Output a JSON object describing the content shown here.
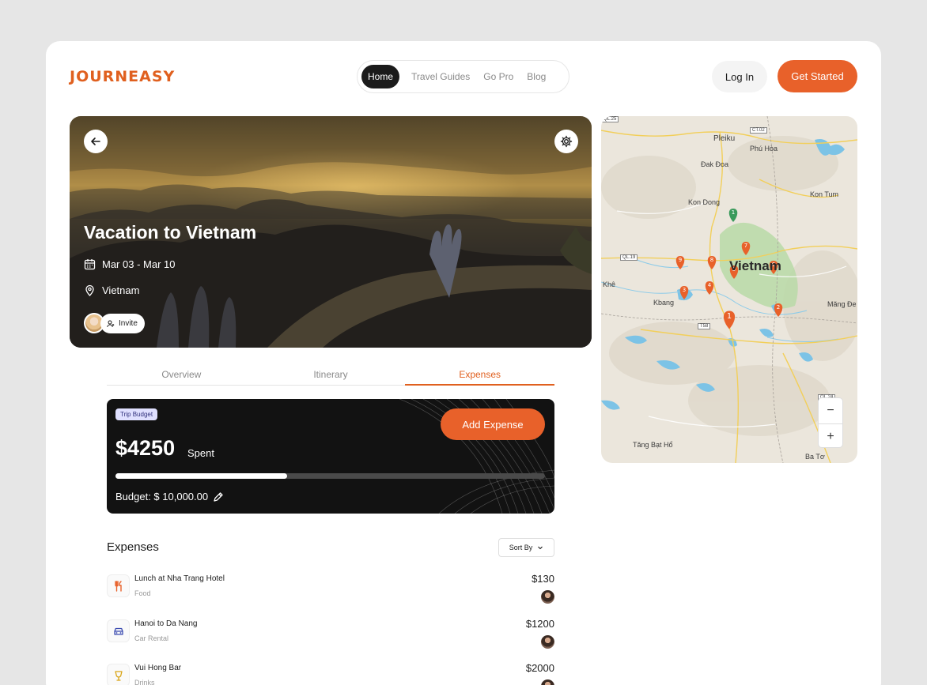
{
  "brand": {
    "logo": "JOURNEASY",
    "accent": "#e8612a"
  },
  "nav": {
    "items": [
      "Home",
      "Travel Guides",
      "Go Pro",
      "Blog"
    ],
    "active": "Home"
  },
  "header": {
    "login_label": "Log In",
    "cta_label": "Get Started"
  },
  "trip": {
    "title": "Vacation to Vietnam",
    "dates": "Mar 03 - Mar 10",
    "location": "Vietnam",
    "invite_label": "Invite"
  },
  "tabs": [
    {
      "label": "Overview"
    },
    {
      "label": "Itinerary"
    },
    {
      "label": "Expenses",
      "active": true
    }
  ],
  "budget": {
    "badge": "Trip Budget",
    "spent_amount": "$4250",
    "spent_label": "Spent",
    "add_label": "Add Expense",
    "total_label": "Budget: $ 10,000.00",
    "progress_fraction": 0.4
  },
  "expenses": {
    "title": "Expenses",
    "sort_label": "Sort By",
    "items": [
      {
        "name": "Lunch at Nha Trang Hotel",
        "category": "Food",
        "amount": "$130",
        "icon": "fork-knife-icon"
      },
      {
        "name": "Hanoi to Da Nang",
        "category": "Car Rental",
        "amount": "$1200",
        "icon": "car-icon"
      },
      {
        "name": "Vui Hong Bar",
        "category": "Drinks",
        "amount": "$2000",
        "icon": "cocktail-icon"
      }
    ]
  },
  "map": {
    "labels": {
      "pleiku": "Pleiku",
      "phu_hoa": "Phú Hòa",
      "dak_doa": "Đak Đoa",
      "kon_dong": "Kon Dong",
      "kon_tum": "Kon Tum",
      "vietnam": "Vietnam",
      "khe": "Khê",
      "kbang": "Kbang",
      "mang_de": "Măng Đe",
      "tang_bat_ho": "Tăng Bạt Hổ",
      "ba_to": "Ba Tơ",
      "ql25": "QL.25",
      "ct02": "CT.02",
      "ql19": "QL.19",
      "t58": "T58",
      "ql24": "QL.24"
    },
    "pins": [
      "1",
      "2",
      "3",
      "4",
      "5",
      "6",
      "7",
      "8",
      "9",
      "1"
    ],
    "zoom_in": "+",
    "zoom_out": "−"
  }
}
